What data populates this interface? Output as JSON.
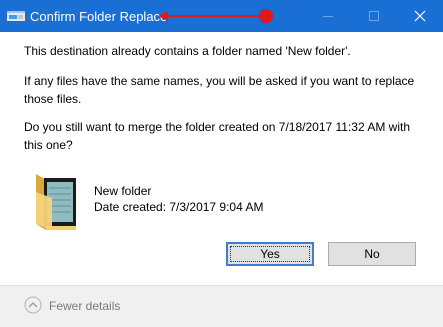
{
  "window": {
    "title": "Confirm Folder Replace",
    "accent_color": "#1a6fd4",
    "annotation_color": "#e0171b"
  },
  "controls": {
    "minimize_icon": "minimize-icon",
    "maximize_icon": "maximize-icon",
    "close_icon": "close-icon"
  },
  "message": {
    "line1": "This destination already contains a folder named 'New folder'.",
    "line2a": "If any files have the same names, you will be asked if you want to replace",
    "line2b": "those files.",
    "line3a": "Do you still want to merge the folder created on 7/18/2017 11:32 AM with",
    "line3b": "this one?"
  },
  "folder": {
    "icon": "folder-icon",
    "name": "New folder",
    "date_created": "Date created: 7/3/2017 9:04 AM"
  },
  "buttons": {
    "yes": "Yes",
    "no": "No"
  },
  "footer": {
    "fewer_details": "Fewer details"
  }
}
